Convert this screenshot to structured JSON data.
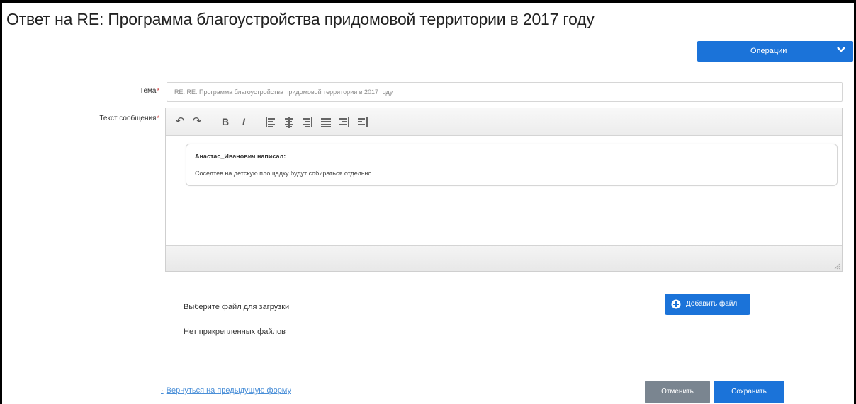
{
  "page": {
    "title": "Ответ на RE: Программа благоустройства придомовой территории в 2017 году"
  },
  "operations": {
    "label": "Операции"
  },
  "form": {
    "subject_label": "Тема",
    "subject_value": "RE: RE: Программа благоустройства придомовой территории в 2017 году",
    "message_label": "Текст сообщения",
    "required_mark": "*",
    "quote_author": "Анастас_Иванович написал:",
    "quote_text": "Соседтев на детскую площадку будут собираться отдельно."
  },
  "toolbar": {
    "undo": "↶",
    "redo": "↷",
    "bold": "B",
    "italic": "I"
  },
  "files": {
    "choose_label": "Выберите файл для загрузки",
    "no_files_label": "Нет прикрепленных файлов",
    "add_button_label": "Добавить файл"
  },
  "footer": {
    "back_link": "Вернуться на предыдущую форму",
    "cancel_label": "Отменить",
    "save_label": "Сохранить"
  },
  "colors": {
    "accent": "#1b73d9",
    "cancel": "#7a8590",
    "link": "#4a8fd8"
  }
}
